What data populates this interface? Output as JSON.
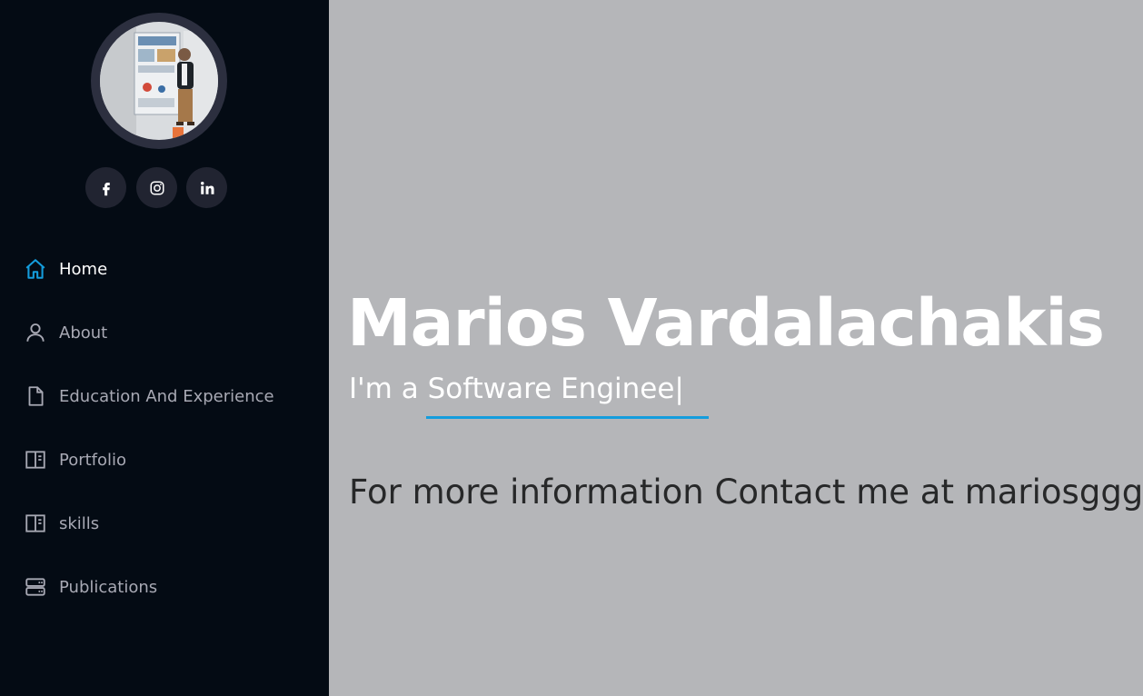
{
  "sidebar": {
    "avatar_alt": "profile photo",
    "social": [
      {
        "icon": "facebook-icon"
      },
      {
        "icon": "instagram-icon"
      },
      {
        "icon": "linkedin-icon"
      }
    ],
    "nav": [
      {
        "label": "Home",
        "icon": "home-icon",
        "active": true
      },
      {
        "label": "About",
        "icon": "person-icon",
        "active": false
      },
      {
        "label": "Education And Experience",
        "icon": "file-icon",
        "active": false
      },
      {
        "label": "Portfolio",
        "icon": "layout-icon",
        "active": false
      },
      {
        "label": "skills",
        "icon": "layout-icon",
        "active": false
      },
      {
        "label": "Publications",
        "icon": "server-icon",
        "active": false
      }
    ]
  },
  "hero": {
    "name": "Marios Vardalachakis",
    "role_prefix": "I'm a",
    "role_typed": "Software Enginee|",
    "contact": "For more information Contact me at mariosggg"
  },
  "colors": {
    "sidebar_bg": "#040b14",
    "accent": "#149ddd",
    "main_bg": "#b5b6b9"
  }
}
